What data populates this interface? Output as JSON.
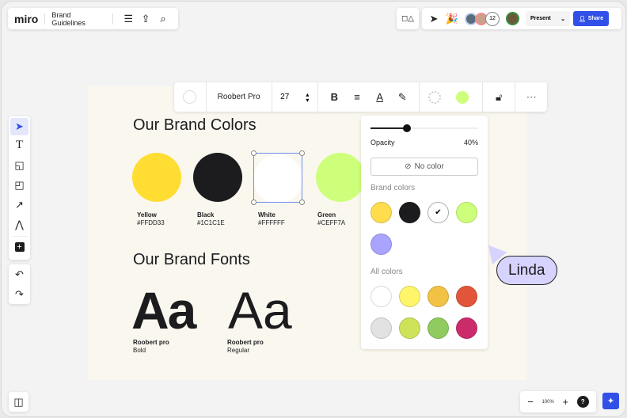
{
  "header": {
    "logo": "miro",
    "board_title": "Brand Guidelines",
    "collaborator_count": "12",
    "present_label": "Present",
    "share_label": "Share"
  },
  "format_toolbar": {
    "font": "Roobert Pro",
    "font_size": "27"
  },
  "board": {
    "colors_heading": "Our Brand Colors",
    "colors": [
      {
        "name": "Yellow",
        "hex": "#FFDD33"
      },
      {
        "name": "Black",
        "hex": "#1C1C1E"
      },
      {
        "name": "White",
        "hex": "#FFFFFF"
      },
      {
        "name": "Green",
        "hex": "#CEFF7A"
      }
    ],
    "fonts_heading": "Our Brand Fonts",
    "fonts": [
      {
        "sample": "Aa",
        "name": "Roobert pro",
        "weight": "Bold"
      },
      {
        "sample": "Aa",
        "name": "Roobert pro",
        "weight": "Regular"
      }
    ]
  },
  "color_picker": {
    "opacity_label": "Opacity",
    "opacity_value": "40%",
    "opacity": 0.4,
    "no_color_label": "No color",
    "brand_colors_label": "Brand colors",
    "brand_colors": [
      "#FFDD4D",
      "#1C1C1E",
      "#FFFFFF",
      "#CEFF7A",
      "#A8A4FF"
    ],
    "selected_brand_color": "#FFFFFF",
    "all_colors_label": "All colors",
    "all_colors": [
      "#FFFFFF",
      "#FFF56B",
      "#F2C245",
      "#E2553A",
      "#E2E2E2",
      "#CEE35A",
      "#8FCB5E",
      "#CC2B6B"
    ]
  },
  "cursor": {
    "name": "Linda",
    "color": "#D7D3FF"
  },
  "zoom": {
    "level": "100%"
  },
  "accent": "#3150E8"
}
